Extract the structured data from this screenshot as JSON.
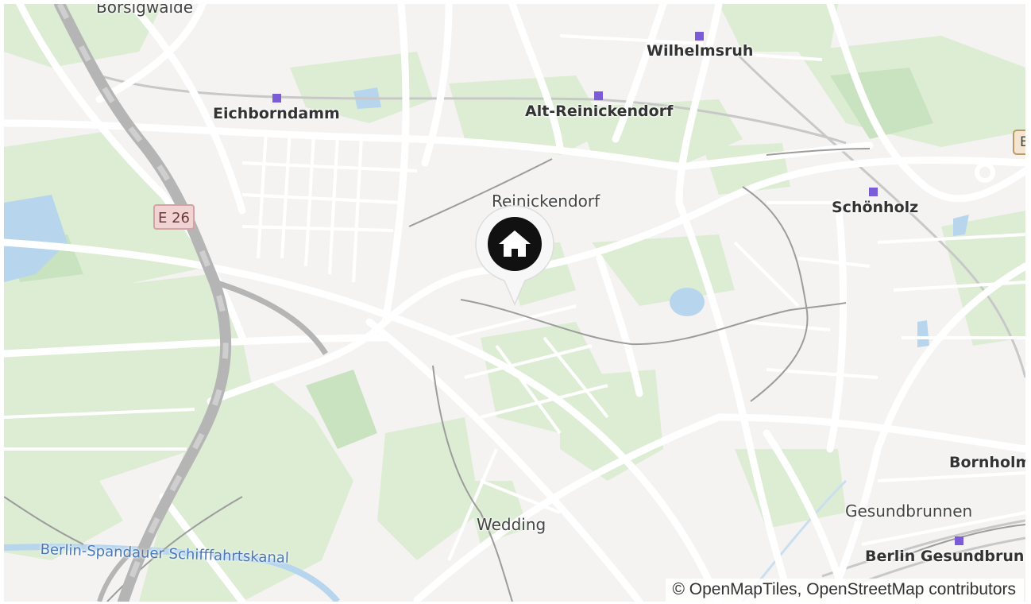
{
  "map": {
    "place_labels": [
      {
        "id": "borsigwalde",
        "text": "Borsigwalde",
        "weight": "normal"
      },
      {
        "id": "wilhelmsruh",
        "text": "Wilhelmsruh",
        "weight": "bold"
      },
      {
        "id": "eichborndamm",
        "text": "Eichborndamm",
        "weight": "bold"
      },
      {
        "id": "alt-reinickendorf",
        "text": "Alt-Reinickendorf",
        "weight": "bold"
      },
      {
        "id": "reinickendorf",
        "text": "Reinickendorf",
        "weight": "normal"
      },
      {
        "id": "schoenholz",
        "text": "Schönholz",
        "weight": "bold"
      },
      {
        "id": "bornholm",
        "text": "Bornholm",
        "weight": "bold"
      },
      {
        "id": "gesundbrunnen",
        "text": "Gesundbrunnen",
        "weight": "normal"
      },
      {
        "id": "berlin-gesundbrunnen",
        "text": "Berlin Gesundbrunn",
        "weight": "bold"
      },
      {
        "id": "wedding",
        "text": "Wedding",
        "weight": "normal"
      }
    ],
    "canal_label": "Berlin-Spandauer Schifffahrtskanal",
    "road_shield": "E 26",
    "edge_badge": "B",
    "marker_icon": "home-icon",
    "attribution": "© OpenMapTiles, OpenStreetMap contributors",
    "colors": {
      "background": "#f4f3f2",
      "park": "#d8eccf",
      "water": "#b7d6ee",
      "road": "#ffffff",
      "motorway": "#b3b3b3",
      "station": "#7b5bd6",
      "marker": "#111111"
    }
  }
}
